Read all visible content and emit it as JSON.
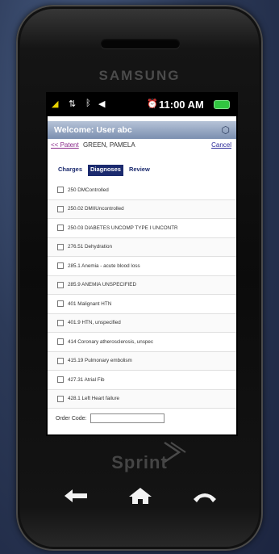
{
  "device": {
    "brand": "SAMSUNG",
    "carrier": "Sprint"
  },
  "status_bar": {
    "time": "11:00 AM"
  },
  "header": {
    "welcome": "Welcome: User abc"
  },
  "patient": {
    "link": "<< Patent",
    "name": "GREEN, PAMELA",
    "cancel": "Cancel"
  },
  "tabs": [
    {
      "label": "Charges",
      "active": false
    },
    {
      "label": "Diagnoses",
      "active": true
    },
    {
      "label": "Review",
      "active": false
    }
  ],
  "diagnoses": [
    {
      "label": "250 DMControlled"
    },
    {
      "label": "250.02 DMIIUncontrolled"
    },
    {
      "label": "250.03 DIABETES UNCOMP TYPE I UNCONTR"
    },
    {
      "label": "276.51 Dehydration"
    },
    {
      "label": "285.1 Anemia - acute blood loss"
    },
    {
      "label": "285.9 ANEMIA UNSPECIFIED"
    },
    {
      "label": "401 Malignant HTN"
    },
    {
      "label": "401.9 HTN, unspecified"
    },
    {
      "label": "414 Coronary atherosclerosis, unspec"
    },
    {
      "label": "415.19 Pulmonary embolism"
    },
    {
      "label": "427.31 Atrial Fib"
    },
    {
      "label": "428.1 Left Heart failure"
    }
  ],
  "order_code": {
    "label": "Order Code:",
    "value": ""
  },
  "colors": {
    "header_bg": "#8b9cba",
    "tab_active_bg": "#1b2a6e",
    "battery": "#31c640",
    "signal": "#e8d200"
  }
}
